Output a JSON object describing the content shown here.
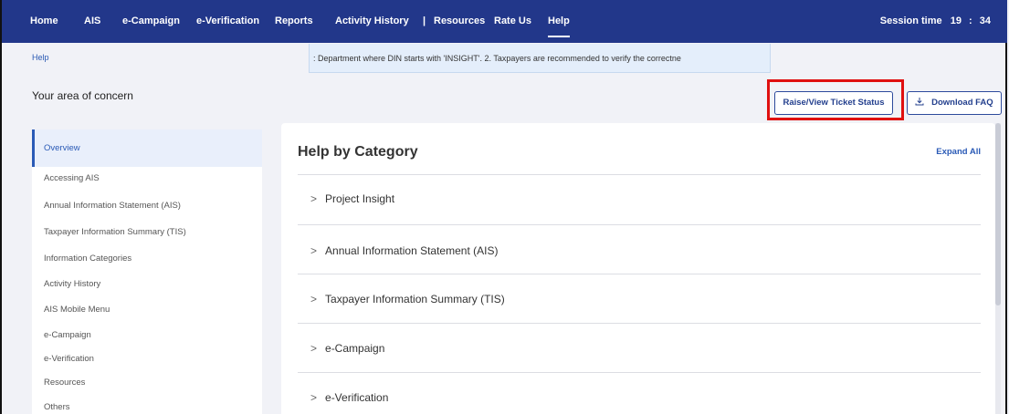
{
  "nav": {
    "items": [
      "Home",
      "AIS",
      "e-Campaign",
      "e-Verification",
      "Reports",
      "Activity History",
      "|",
      "Resources",
      "Rate Us",
      "Help"
    ],
    "active": "Help",
    "session_label": "Session time",
    "session_minutes": "19",
    "session_colon": ":",
    "session_seconds": "34"
  },
  "breadcrumb": "Help",
  "marquee": ": Department where DIN starts with 'INSIGHT'.  2. Taxpayers are recommended to verify the correctne",
  "area_title": "Your area of concern",
  "buttons": {
    "raise": "Raise/View Ticket Status",
    "download": "Download FAQ",
    "download_icon": "download-icon"
  },
  "sidebar": {
    "items": [
      "Overview",
      "Accessing AIS",
      "Annual Information Statement (AIS)",
      "Taxpayer Information Summary (TIS)",
      "Information Categories",
      "Activity History",
      "AIS Mobile Menu",
      "e-Campaign",
      "e-Verification",
      "Resources",
      "Others"
    ],
    "active": "Overview"
  },
  "panel": {
    "title": "Help by Category",
    "expand_all": "Expand All",
    "categories": [
      "Project Insight",
      "Annual Information Statement (AIS)",
      "Taxpayer Information Summary (TIS)",
      "e-Campaign",
      "e-Verification"
    ],
    "chevron": ">"
  },
  "colors": {
    "nav_bg": "#22378a",
    "accent": "#2a5ab6",
    "highlight": "#e01010"
  }
}
